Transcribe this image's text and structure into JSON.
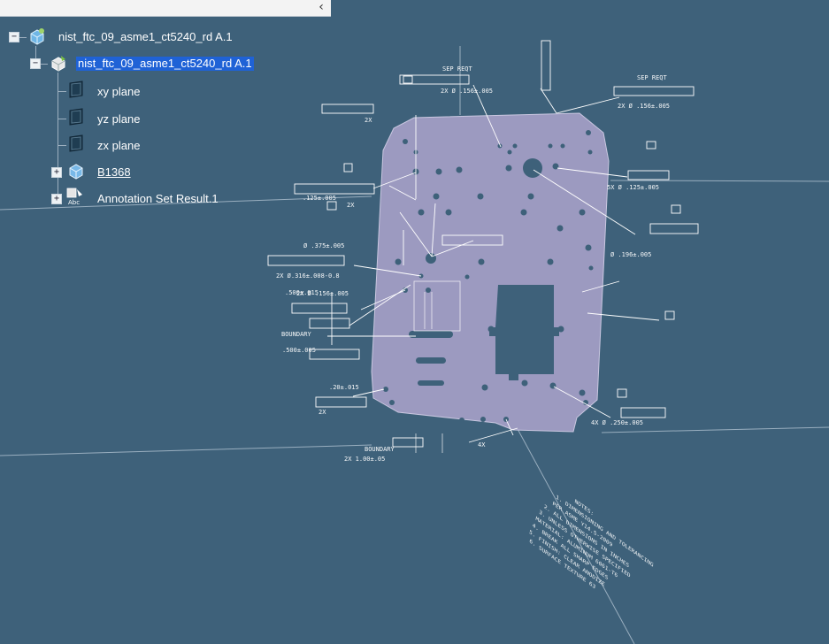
{
  "panel": {
    "collapse_glyph": "‹"
  },
  "tree": {
    "root": {
      "label": "nist_ftc_09_asme1_ct5240_rd A.1",
      "icon": "product-icon",
      "expander": "−"
    },
    "part": {
      "label": "nist_ftc_09_asme1_ct5240_rd A.1",
      "icon": "part-icon",
      "expander": "−",
      "selected": true
    },
    "planes": [
      {
        "label": "xy plane",
        "icon": "plane-icon"
      },
      {
        "label": "yz plane",
        "icon": "plane-icon"
      },
      {
        "label": "zx plane",
        "icon": "plane-icon"
      }
    ],
    "body": {
      "label": "B1368",
      "icon": "body-icon",
      "expander": "+"
    },
    "annotation_set": {
      "label": "Annotation Set Result.1",
      "icon": "annotation-set-icon",
      "expander": "+"
    }
  },
  "colors": {
    "background": "#3e617a",
    "plate": "#9c9ac0",
    "annotation": "#ffffff",
    "selection": "#1f62d6"
  }
}
